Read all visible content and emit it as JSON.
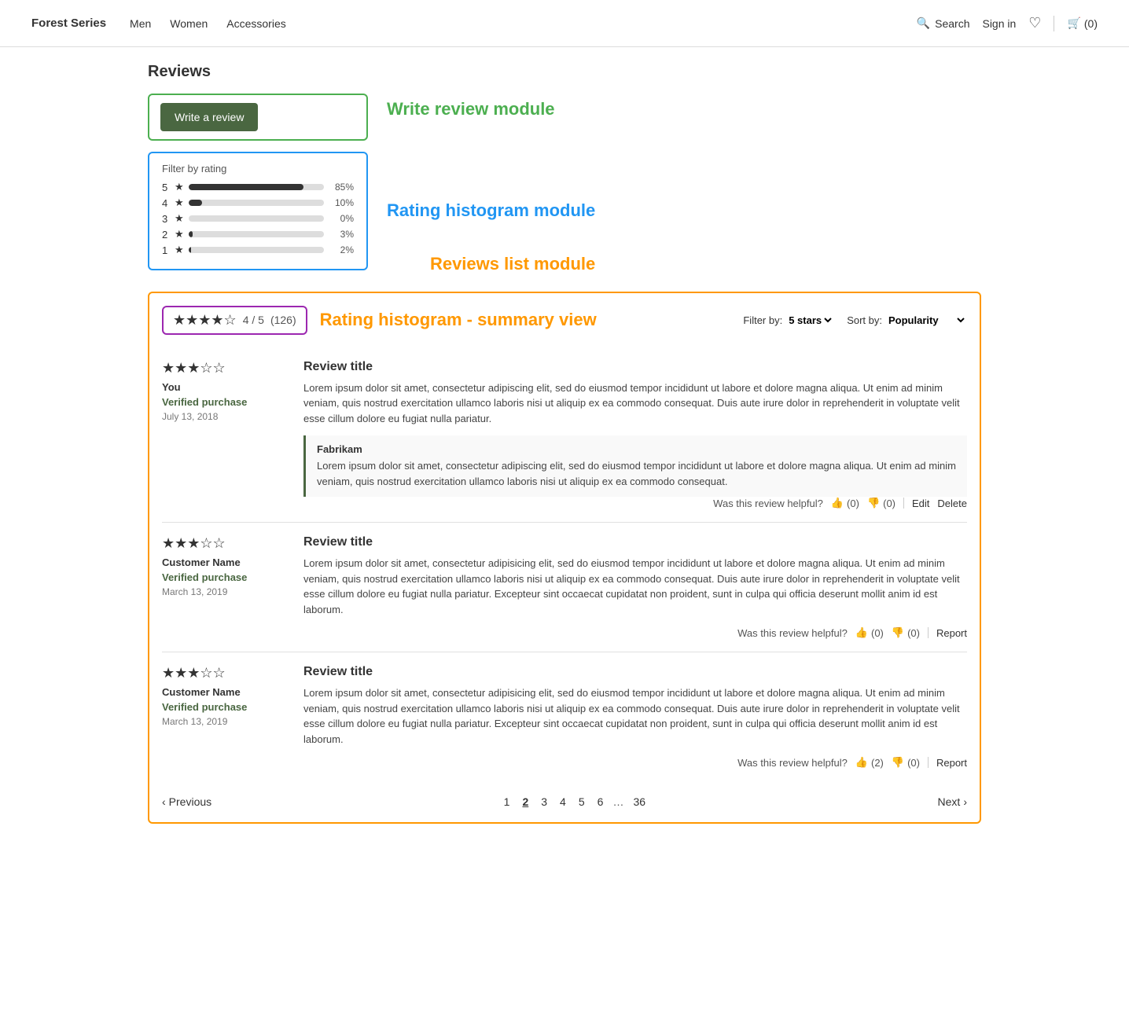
{
  "nav": {
    "logo": "Forest Series",
    "links": [
      "Men",
      "Women",
      "Accessories"
    ],
    "search_label": "Search",
    "sign_in_label": "Sign in",
    "cart_count": "(0)"
  },
  "page": {
    "title": "Reviews"
  },
  "write_review_module_label": "Write review module",
  "write_review_btn_label": "Write a review",
  "rating_histogram_module_label": "Rating histogram module",
  "filter_label": "Filter by rating",
  "histogram": [
    {
      "star": 5,
      "pct": 85,
      "label": "85%"
    },
    {
      "star": 4,
      "pct": 10,
      "label": "10%"
    },
    {
      "star": 3,
      "pct": 0,
      "label": "0%"
    },
    {
      "star": 2,
      "pct": 3,
      "label": "3%"
    },
    {
      "star": 1,
      "pct": 2,
      "label": "2%"
    }
  ],
  "reviews_list_module_label": "Reviews list module",
  "summary_view_label": "Rating histogram - summary view",
  "summary_stars": "★★★★☆",
  "summary_score": "4 / 5",
  "summary_count": "(126)",
  "filter_by_label": "Filter by:",
  "filter_value": "5 stars ▾",
  "sort_by_label": "Sort by:",
  "sort_value": "Popularity ▾",
  "reviews": [
    {
      "stars_filled": 3,
      "stars_empty": 2,
      "author": "You",
      "verified": "Verified purchase",
      "date": "July 13, 2018",
      "title": "Review title",
      "body": "Lorem ipsum dolor sit amet, consectetur adipiscing elit, sed do eiusmod tempor incididunt ut labore et dolore magna aliqua. Ut enim ad minim veniam, quis nostrud exercitation ullamco laboris nisi ut aliquip ex ea commodo consequat. Duis aute irure dolor in reprehenderit in voluptate velit esse cillum dolore eu fugiat nulla pariatur.",
      "helpful_label": "Was this review helpful?",
      "thumbs_up": 0,
      "thumbs_down": 0,
      "actions": [
        "Edit",
        "Delete"
      ],
      "response": {
        "author": "Fabrikam",
        "body": "Lorem ipsum dolor sit amet, consectetur adipiscing elit, sed do eiusmod tempor incididunt ut labore et dolore magna aliqua. Ut enim ad minim veniam, quis nostrud exercitation ullamco laboris nisi ut aliquip ex ea commodo consequat."
      }
    },
    {
      "stars_filled": 3,
      "stars_empty": 2,
      "author": "Customer Name",
      "verified": "Verified purchase",
      "date": "March 13, 2019",
      "title": "Review title",
      "body": "Lorem ipsum dolor sit amet, consectetur adipisicing elit, sed do eiusmod tempor incididunt ut labore et dolore magna aliqua. Ut enim ad minim veniam, quis nostrud exercitation ullamco laboris nisi ut aliquip ex ea commodo consequat. Duis aute irure dolor in reprehenderit in voluptate velit esse cillum dolore eu fugiat nulla pariatur. Excepteur sint occaecat cupidatat non proident, sunt in culpa qui officia deserunt mollit anim id est laborum.",
      "helpful_label": "Was this review helpful?",
      "thumbs_up": 0,
      "thumbs_down": 0,
      "actions": [
        "Report"
      ],
      "response": null
    },
    {
      "stars_filled": 3,
      "stars_empty": 2,
      "author": "Customer Name",
      "verified": "Verified purchase",
      "date": "March 13, 2019",
      "title": "Review title",
      "body": "Lorem ipsum dolor sit amet, consectetur adipisicing elit, sed do eiusmod tempor incididunt ut labore et dolore magna aliqua. Ut enim ad minim veniam, quis nostrud exercitation ullamco laboris nisi ut aliquip ex ea commodo consequat. Duis aute irure dolor in reprehenderit in voluptate velit esse cillum dolore eu fugiat nulla pariatur. Excepteur sint occaecat cupidatat non proident, sunt in culpa qui officia deserunt mollit anim id est laborum.",
      "helpful_label": "Was this review helpful?",
      "thumbs_up": 2,
      "thumbs_down": 0,
      "actions": [
        "Report"
      ],
      "response": null
    }
  ],
  "pagination": {
    "prev_label": "Previous",
    "next_label": "Next",
    "pages": [
      "1",
      "2",
      "3",
      "4",
      "5",
      "6",
      "...",
      "36"
    ],
    "active_page": "2"
  }
}
